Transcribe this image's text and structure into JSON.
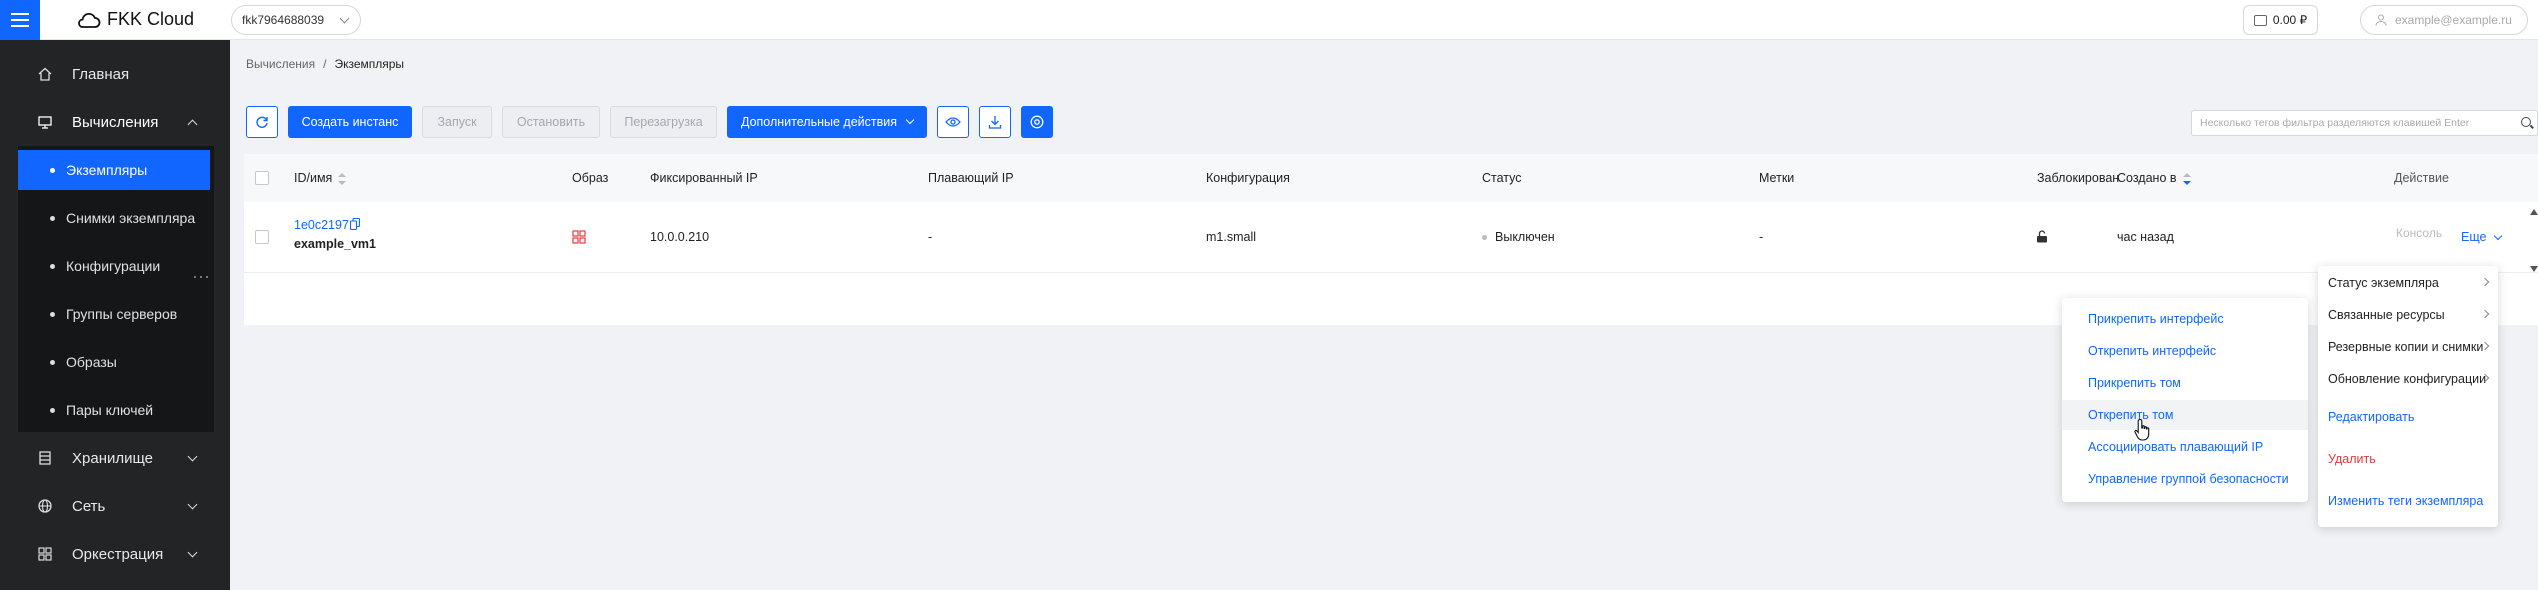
{
  "app": {
    "logo_text": "FKK Cloud"
  },
  "header": {
    "project": "fkk7964688039",
    "balance": "0.00 ₽",
    "user_email": "example@example.ru"
  },
  "sidebar": {
    "items": [
      {
        "label": "Главная",
        "icon": "home-icon"
      },
      {
        "label": "Вычисления",
        "icon": "monitor-icon"
      },
      {
        "label": "Хранилище",
        "icon": "storage-icon"
      },
      {
        "label": "Сеть",
        "icon": "globe-icon"
      },
      {
        "label": "Оркестрация",
        "icon": "grid-icon"
      }
    ],
    "compute_sub": [
      {
        "label": "Экземпляры"
      },
      {
        "label": "Снимки экземпляра"
      },
      {
        "label": "Конфигурации"
      },
      {
        "label": "Группы серверов"
      },
      {
        "label": "Образы"
      },
      {
        "label": "Пары ключей"
      }
    ]
  },
  "breadcrumb": {
    "parent": "Вычисления",
    "separator": "/",
    "current": "Экземпляры"
  },
  "toolbar": {
    "create": "Создать инстанс",
    "start": "Запуск",
    "stop": "Остановить",
    "reboot": "Перезагрузка",
    "more_actions": "Дополнительные действия",
    "filter_placeholder": "Несколько тегов фильтра разделяются клавишей Enter"
  },
  "table": {
    "columns": {
      "id_name": "ID/имя",
      "image": "Образ",
      "fixed_ip": "Фиксированный IP",
      "floating_ip": "Плавающий IP",
      "flavor": "Конфигурация",
      "status": "Статус",
      "tags": "Метки",
      "locked": "Заблокирован",
      "created": "Создано в",
      "action": "Действие"
    },
    "rows": [
      {
        "id": "1e0c2197",
        "name": "example_vm1",
        "fixed_ip": "10.0.0.210",
        "floating_ip": "-",
        "flavor": "m1.small",
        "status": "Выключен",
        "tags": "-",
        "created": "час назад",
        "console": "Консоль",
        "more": "Еще"
      }
    ]
  },
  "more_menu": [
    {
      "label": "Статус экземпляра",
      "submenu": true
    },
    {
      "label": "Связанные ресурсы",
      "submenu": true
    },
    {
      "label": "Резервные копии и снимки",
      "submenu": true
    },
    {
      "label": "Обновление конфигурации",
      "submenu": true
    },
    {
      "label": "Редактировать",
      "submenu": false
    },
    {
      "label": "Удалить",
      "submenu": false
    },
    {
      "label": "Изменить теги экземпляра",
      "submenu": false
    }
  ],
  "resources_submenu": [
    {
      "label": "Прикрепить интерфейс"
    },
    {
      "label": "Открепить интерфейс"
    },
    {
      "label": "Прикрепить том"
    },
    {
      "label": "Открепить том"
    },
    {
      "label": "Ассоциировать плавающий IP"
    },
    {
      "label": "Управление группой безопасности"
    }
  ],
  "colors": {
    "accent": "#1166ff",
    "danger": "#e8383d",
    "sidebar_bg": "#222426"
  }
}
